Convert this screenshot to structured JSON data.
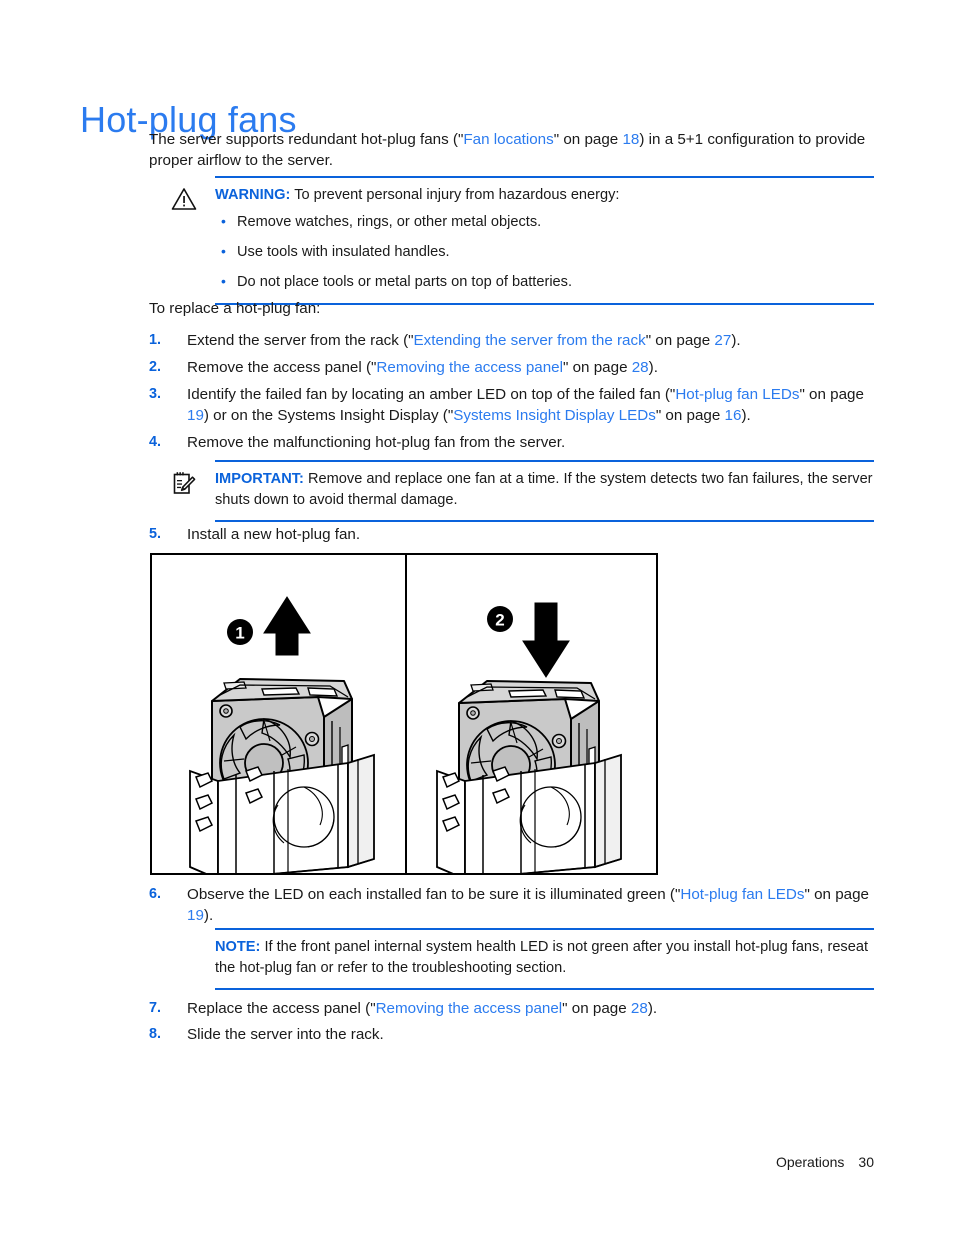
{
  "page": {
    "heading": "Hot-plug fans",
    "intro": {
      "before_link": "The server supports redundant hot-plug fans (\"",
      "link": "Fan locations",
      "after_link": "\" on page ",
      "page": "18",
      "tail": ") in a 5+1 configuration to provide proper airflow to the server."
    },
    "lead_in": "To replace a hot-plug fan:"
  },
  "warning": {
    "icon": "warning-triangle-icon",
    "label": "WARNING:",
    "text": "To prevent personal injury from hazardous energy:",
    "bullets": [
      "Remove watches, rings, or other metal objects.",
      "Use tools with insulated handles.",
      "Do not place tools or metal parts on top of batteries."
    ]
  },
  "important": {
    "icon": "notepad-pencil-icon",
    "label": "IMPORTANT:",
    "text": "Remove and replace one fan at a time. If the system detects two fan failures, the server shuts down to avoid thermal damage."
  },
  "note": {
    "label": "NOTE:",
    "text": "If the front panel internal system health LED is not green after you install hot-plug fans, reseat the hot-plug fan or refer to the troubleshooting section."
  },
  "steps": [
    {
      "num": "1.",
      "html": "Extend the server from the rack (\"<span class=\"xref\">Extending the server from the rack</span>\" on page <span class=\"pgnum\">27</span>).",
      "plain": "Extend the server from the rack (\"Extending the server from the rack\" on page 27).",
      "links": [
        "Extending the server from the rack"
      ],
      "pages": [
        "27"
      ]
    },
    {
      "num": "2.",
      "html": "Remove the access panel (\"<span class=\"xref\">Removing the access panel</span>\" on page <span class=\"pgnum\">28</span>).",
      "plain": "Remove the access panel (\"Removing the access panel\" on page 28).",
      "links": [
        "Removing the access panel"
      ],
      "pages": [
        "28"
      ]
    },
    {
      "num": "3.",
      "html": "Identify the failed fan by locating an amber LED on top of the failed fan (\"<span class=\"xref\">Hot-plug fan LEDs</span>\" on page <span class=\"pgnum\">19</span>) or on the Systems Insight Display (\"<span class=\"xref\">Systems Insight Display LEDs</span>\" on page <span class=\"pgnum\">16</span>).",
      "plain": "Identify the failed fan by locating an amber LED on top of the failed fan (\"Hot-plug fan LEDs\" on page 19) or on the Systems Insight Display (\"Systems Insight Display LEDs\" on page 16).",
      "links": [
        "Hot-plug fan LEDs",
        "Systems Insight Display LEDs"
      ],
      "pages": [
        "19",
        "16"
      ]
    },
    {
      "num": "4.",
      "html": "Remove the malfunctioning hot-plug fan from the server.",
      "plain": "Remove the malfunctioning hot-plug fan from the server.",
      "links": [],
      "pages": []
    },
    {
      "num": "5.",
      "html": "Install a new hot-plug fan.",
      "plain": "Install a new hot-plug fan.",
      "links": [],
      "pages": []
    },
    {
      "num": "6.",
      "html": "Observe the LED on each installed fan to be sure it is illuminated green (\"<span class=\"xref\">Hot-plug fan LEDs</span>\" on page <span class=\"pgnum\">19</span>).",
      "plain": "Observe the LED on each installed fan to be sure it is illuminated green (\"Hot-plug fan LEDs\" on page 19).",
      "links": [
        "Hot-plug fan LEDs"
      ],
      "pages": [
        "19"
      ]
    },
    {
      "num": "7.",
      "html": "Replace the access panel (\"<span class=\"xref\">Removing the access panel</span>\" on page <span class=\"pgnum\">28</span>).",
      "plain": "Replace the access panel (\"Removing the access panel\" on page 28).",
      "links": [
        "Removing the access panel"
      ],
      "pages": [
        "28"
      ]
    },
    {
      "num": "8.",
      "html": "Slide the server into the rack.",
      "plain": "Slide the server into the rack.",
      "links": [],
      "pages": []
    }
  ],
  "figure": {
    "panels": [
      {
        "callout": "1",
        "direction": "up",
        "description": "Hot-plug fan being lifted out of the fan cage"
      },
      {
        "callout": "2",
        "direction": "down",
        "description": "Hot-plug fan being pressed down into the fan cage"
      }
    ]
  },
  "footer": {
    "section": "Operations",
    "page_number": "30"
  },
  "colors": {
    "heading_blue": "#2B7BEF",
    "link_blue": "#2B7BEF",
    "rule_blue": "#0A62DB",
    "body_black": "#1a1a1a"
  }
}
